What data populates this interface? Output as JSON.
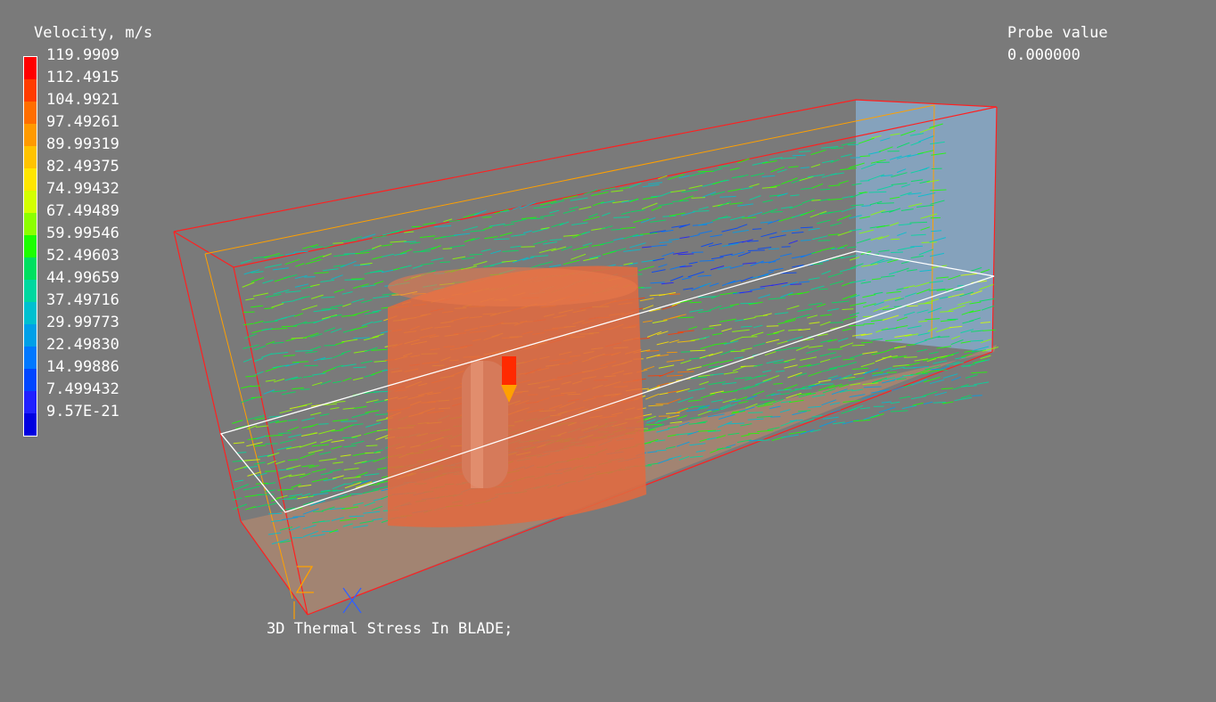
{
  "legend": {
    "title": "Velocity, m/s",
    "entries": [
      {
        "label": "119.9909",
        "color": "#ff0000"
      },
      {
        "label": "112.4915",
        "color": "#ff3c00"
      },
      {
        "label": "104.9921",
        "color": "#ff6e00"
      },
      {
        "label": "97.49261",
        "color": "#ff9a00"
      },
      {
        "label": "89.99319",
        "color": "#ffc300"
      },
      {
        "label": "82.49375",
        "color": "#ffe600"
      },
      {
        "label": "74.99432",
        "color": "#d4ff00"
      },
      {
        "label": "67.49489",
        "color": "#8cff00"
      },
      {
        "label": "59.99546",
        "color": "#1cff00"
      },
      {
        "label": "52.49603",
        "color": "#00e060"
      },
      {
        "label": "44.99659",
        "color": "#00d8a0"
      },
      {
        "label": "37.49716",
        "color": "#00c0d0"
      },
      {
        "label": "29.99773",
        "color": "#00a0e8"
      },
      {
        "label": "22.49830",
        "color": "#0078ff"
      },
      {
        "label": "14.99886",
        "color": "#0046ff"
      },
      {
        "label": "7.499432",
        "color": "#2020ff"
      },
      {
        "label": "9.57E-21",
        "color": "#0000e0"
      }
    ]
  },
  "probe": {
    "title": "Probe value",
    "value": "0.000000"
  },
  "caption": "3D Thermal Stress In BLADE;",
  "axes": {
    "z_label": "Z",
    "x_label": "X",
    "z_color": "#ffa000",
    "x_color": "#3060ff"
  },
  "colors": {
    "background": "#7a7a7a",
    "blade": "#e06a40",
    "domain_box": "#ff2020",
    "inner_box": "#ffa000",
    "plane": "#ffffff",
    "outlet": "#8ab4d8"
  }
}
